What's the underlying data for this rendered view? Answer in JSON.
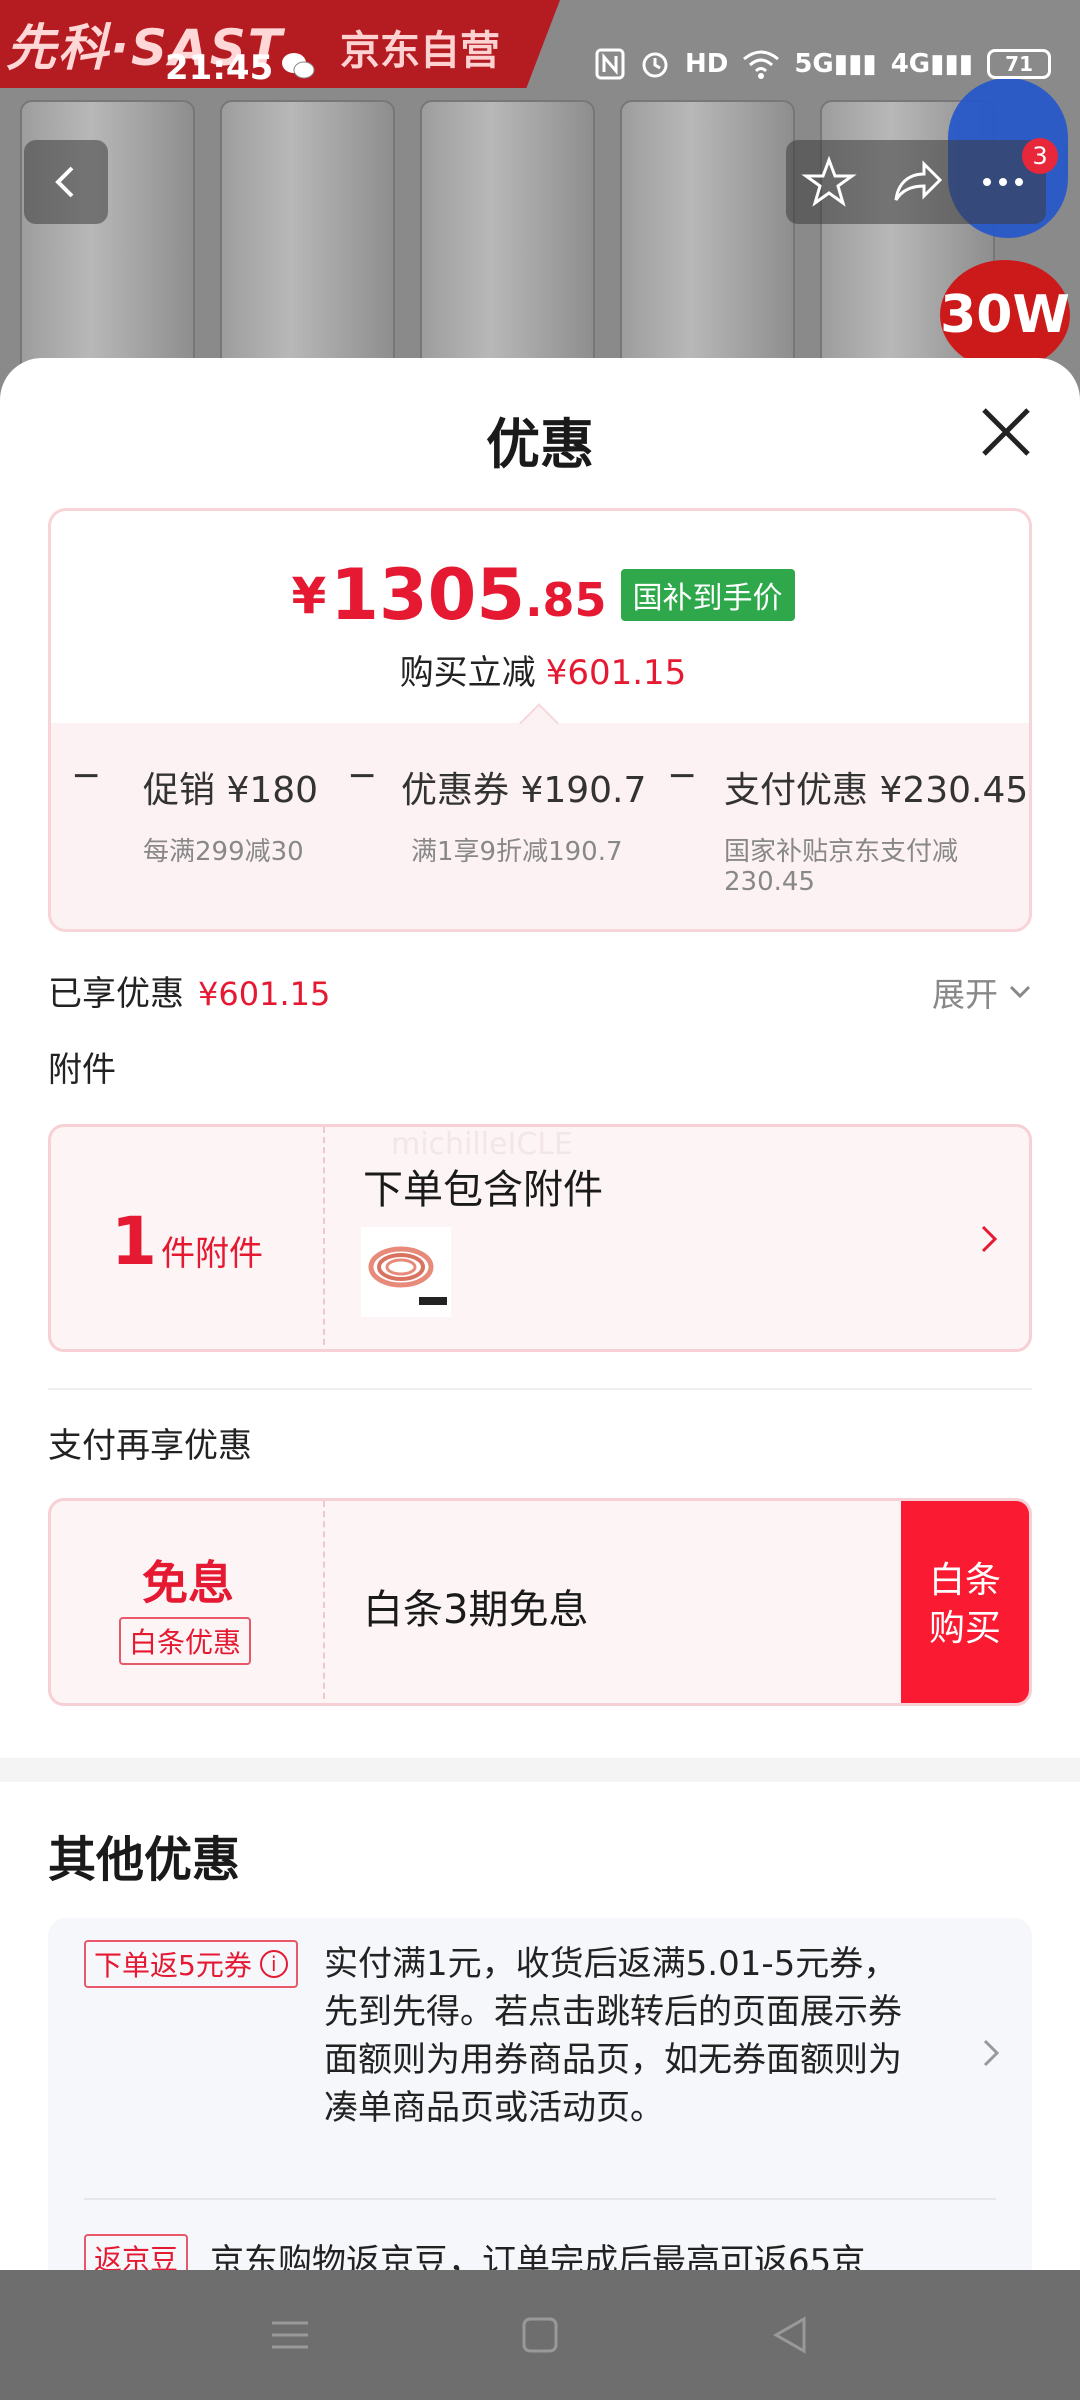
{
  "status_bar": {
    "time": "21:45",
    "battery": "71",
    "icons": [
      "nfc-icon",
      "alarm-icon",
      "hd-icon",
      "wifi-icon",
      "5g-signal-icon",
      "4g-signal-icon"
    ],
    "net_5g": "5G",
    "net_4g": "4G",
    "hd": "HD"
  },
  "background_page": {
    "brand": "先科·SAST",
    "brand_suffix": "京东自营",
    "badge_count": "3",
    "wattage": "30W"
  },
  "sheet": {
    "title": "优惠",
    "price": {
      "symbol": "¥",
      "integer": "1305",
      "decimal": ".85",
      "tag": "国补到手价",
      "reduce_label": "购买立减",
      "reduce_amount": "¥601.15"
    },
    "breakdown": [
      {
        "label": "促销 ¥180",
        "sub": "每满299减30"
      },
      {
        "label": "优惠券 ¥190.7",
        "sub": "满1享9折减190.7"
      },
      {
        "label": "支付优惠 ¥230.45",
        "sub_line1": "国家补贴京东支付减",
        "sub_line2": "230.45"
      }
    ],
    "enjoyed_label": "已享优惠",
    "enjoyed_amount": "¥601.15",
    "expand_label": "展开",
    "accessory_section": "附件",
    "accessory": {
      "count": "1",
      "unit": "件附件",
      "title": "下单包含附件",
      "watermark": "michilleICLE"
    },
    "payment_section": "支付再享优惠",
    "payment": {
      "main": "免息",
      "sub": "白条优惠",
      "title": "白条3期免息",
      "button_line1": "白条",
      "button_line2": "购买"
    },
    "other_title": "其他优惠",
    "other": [
      {
        "tag": "下单返5元券",
        "lines": [
          "实付满1元，收货后返满5.01-5元券，",
          "先到先得。若点击跳转后的页面展示券",
          "面额则为用券商品页，如无券面额则为",
          "凑单商品页或活动页。"
        ]
      },
      {
        "tag": "返京豆",
        "text": "京东购物返京豆，订单完成后最高可返65京"
      }
    ]
  },
  "colors": {
    "accent_red": "#e51a32",
    "subsidy_green": "#2ea84b",
    "button_red": "#fa1a31"
  }
}
